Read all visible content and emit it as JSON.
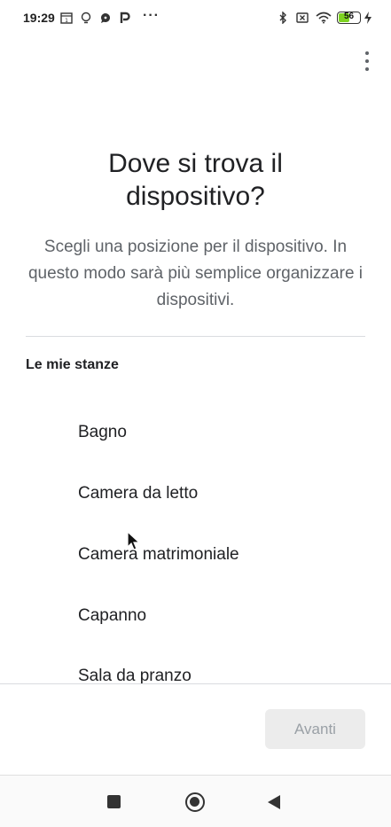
{
  "status_bar": {
    "time": "19:29",
    "overflow_dots": "···",
    "battery_percent": 56,
    "battery_label": "56",
    "left_icons": [
      "calendar-icon",
      "lightbulb-icon",
      "chat-bubble-icon",
      "parking-icon"
    ],
    "right_icons": [
      "bluetooth-icon",
      "no-sim-icon",
      "wifi-icon",
      "battery-icon",
      "charging-icon"
    ]
  },
  "toolbar": {
    "overflow_icon": "more-vert-icon"
  },
  "page": {
    "title": "Dove si trova il dispositivo?",
    "subtitle": "Scegli una posizione per il dispositivo. In questo modo sarà più semplice organizzare i dispositivi."
  },
  "rooms": {
    "section_label": "Le mie stanze",
    "items": [
      {
        "label": "Bagno"
      },
      {
        "label": "Camera da letto"
      },
      {
        "label": "Camera matrimoniale"
      },
      {
        "label": "Capanno"
      },
      {
        "label": "Sala da pranzo"
      }
    ]
  },
  "footer": {
    "next_label": "Avanti",
    "next_enabled": false
  },
  "nav_bar": {
    "icons": [
      "recents-square-icon",
      "home-circle-icon",
      "back-triangle-icon"
    ]
  },
  "colors": {
    "battery_fill": "#7ed321",
    "button_bg_disabled": "#ececec",
    "button_text_disabled": "#9aa0a6"
  }
}
